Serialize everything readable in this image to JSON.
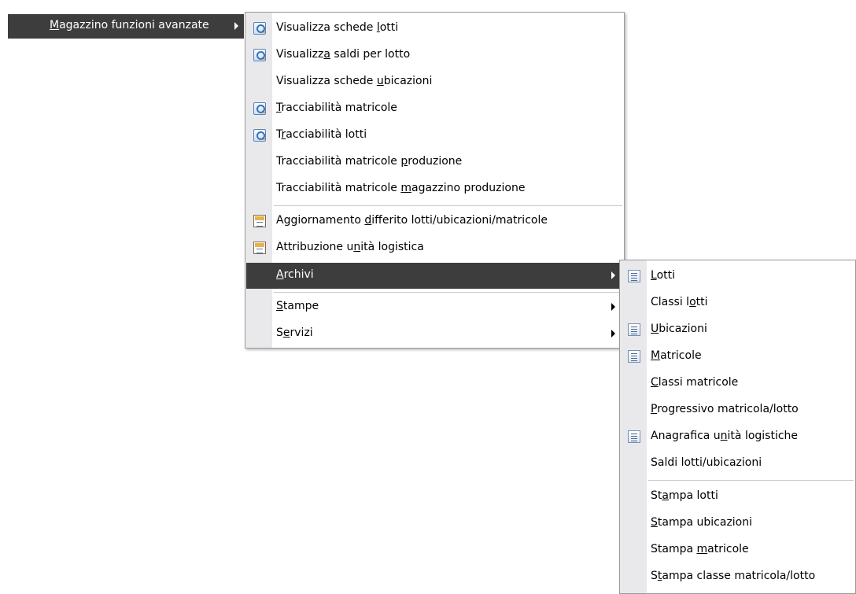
{
  "top_menu": {
    "label_pre": "",
    "label_mn": "M",
    "label_post": "agazzino funzioni avanzate"
  },
  "submenu1": {
    "items": [
      {
        "pre": "Visualizza schede ",
        "mn": "l",
        "post": "otti",
        "icon": "view-search-icon"
      },
      {
        "pre": "Visualizz",
        "mn": "a",
        "post": " saldi per lotto",
        "icon": "view-search-icon"
      },
      {
        "pre": "Visualizza schede ",
        "mn": "u",
        "post": "bicazioni",
        "icon": ""
      },
      {
        "pre": "",
        "mn": "T",
        "post": "racciabilità matricole",
        "icon": "view-search-icon"
      },
      {
        "pre": "T",
        "mn": "r",
        "post": "acciabilità lotti",
        "icon": "view-search-icon"
      },
      {
        "pre": "Tracciabilità matricole ",
        "mn": "p",
        "post": "roduzione",
        "icon": ""
      },
      {
        "pre": "Tracciabilità matricole ",
        "mn": "m",
        "post": "agazzino produzione",
        "icon": ""
      },
      {
        "pre": "Aggiornamento ",
        "mn": "d",
        "post": "ifferito lotti/ubicazioni/matricole",
        "icon": "document-icon"
      },
      {
        "pre": "Attribuzione u",
        "mn": "n",
        "post": "ità logistica",
        "icon": "document-icon"
      },
      {
        "pre": "",
        "mn": "A",
        "post": "rchivi",
        "icon": "",
        "submenu": true,
        "selected": true
      },
      {
        "pre": "",
        "mn": "S",
        "post": "tampe",
        "icon": "",
        "submenu": true
      },
      {
        "pre": "S",
        "mn": "e",
        "post": "rvizi",
        "icon": "",
        "submenu": true
      }
    ]
  },
  "submenu2": {
    "items": [
      {
        "pre": "",
        "mn": "L",
        "post": "otti",
        "icon": "list-icon"
      },
      {
        "pre": "Classi l",
        "mn": "o",
        "post": "tti",
        "icon": ""
      },
      {
        "pre": "",
        "mn": "U",
        "post": "bicazioni",
        "icon": "list-icon"
      },
      {
        "pre": "",
        "mn": "M",
        "post": "atricole",
        "icon": "list-icon"
      },
      {
        "pre": "",
        "mn": "C",
        "post": "lassi matricole",
        "icon": ""
      },
      {
        "pre": "",
        "mn": "P",
        "post": "rogressivo matricola/lotto",
        "icon": ""
      },
      {
        "pre": "Anagrafica u",
        "mn": "n",
        "post": "ità logistiche",
        "icon": "list-icon"
      },
      {
        "pre": "Saldi lotti/ubicazioni",
        "mn": "",
        "post": "",
        "icon": ""
      },
      {
        "pre": "St",
        "mn": "a",
        "post": "mpa lotti",
        "icon": ""
      },
      {
        "pre": "",
        "mn": "S",
        "post": "tampa ubicazioni",
        "icon": ""
      },
      {
        "pre": "Stampa ",
        "mn": "m",
        "post": "atricole",
        "icon": ""
      },
      {
        "pre": "S",
        "mn": "t",
        "post": "ampa classe matricola/lotto",
        "icon": ""
      }
    ]
  },
  "colors": {
    "selected_bg": "#3d3d3d",
    "gutter_bg": "#e9e9ec",
    "separator": "#c8c8c8"
  }
}
